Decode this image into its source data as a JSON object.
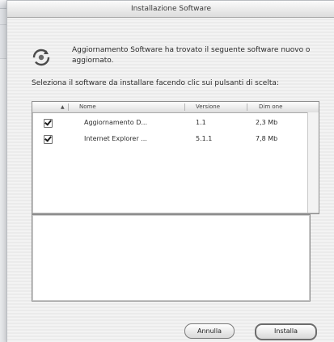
{
  "window": {
    "title": "Installazione Software"
  },
  "message": "Aggiornamento Software ha trovato il seguente software nuovo o aggiornato.",
  "instruction": "Seleziona il software da installare facendo clic sui pulsanti di scelta:",
  "table": {
    "columns": {
      "install": "",
      "name": "Nome",
      "version": "Versione",
      "size": "Dim   one"
    },
    "rows": [
      {
        "checked": true,
        "name": "Aggiornamento D...",
        "version": "1.1",
        "size": "2,3 Mb"
      },
      {
        "checked": true,
        "name": "Internet Explorer ...",
        "version": "5.1.1",
        "size": "7,8 Mb"
      }
    ]
  },
  "buttons": {
    "cancel": "Annulla",
    "install": "Installa"
  }
}
